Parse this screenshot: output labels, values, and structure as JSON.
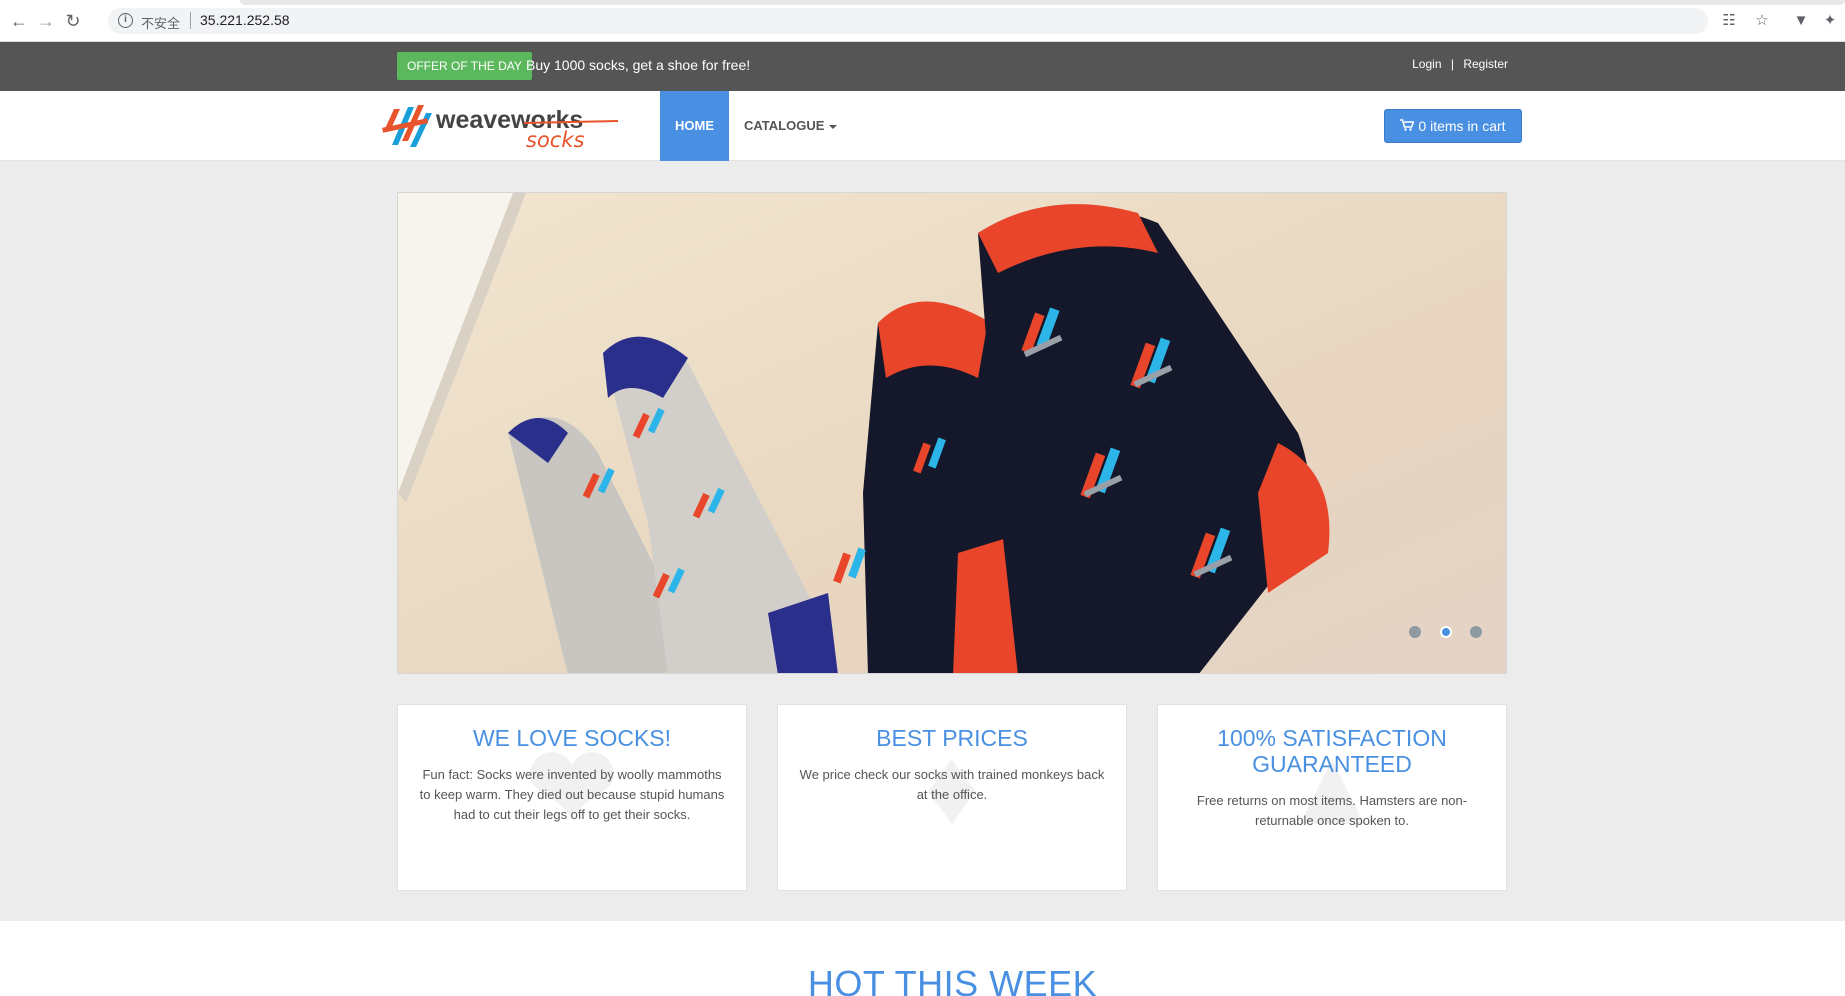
{
  "browser": {
    "insecure_label": "不安全",
    "url": "35.221.252.58"
  },
  "topbar": {
    "offer_badge": "OFFER OF THE DAY",
    "offer_text": "Buy 1000 socks, get a shoe for free!",
    "login": "Login",
    "separator": "|",
    "register": "Register"
  },
  "navbar": {
    "logo_text_main": "weaveworks",
    "logo_text_sub": "socks",
    "home": "HOME",
    "catalogue": "CATALOGUE",
    "cart": "0 items in cart"
  },
  "carousel": {
    "slide_count": 3,
    "active_index": 1
  },
  "features": [
    {
      "title": "WE LOVE SOCKS!",
      "text": "Fun fact: Socks were invented by woolly mammoths to keep warm. They died out because stupid humans had to cut their legs off to get their socks.",
      "icon": "heart-icon"
    },
    {
      "title": "BEST PRICES",
      "text": "We price check our socks with trained monkeys back at the office.",
      "icon": "tag-icon"
    },
    {
      "title": "100% SATISFACTION GUARANTEED",
      "text": "Free returns on most items. Hamsters are non-returnable once spoken to.",
      "icon": "thumbs-up-icon"
    }
  ],
  "hot_section": {
    "title": "HOT THIS WEEK"
  },
  "colors": {
    "accent": "#4a90e2",
    "offer_green": "#5cb85c",
    "topbar": "#555555"
  }
}
